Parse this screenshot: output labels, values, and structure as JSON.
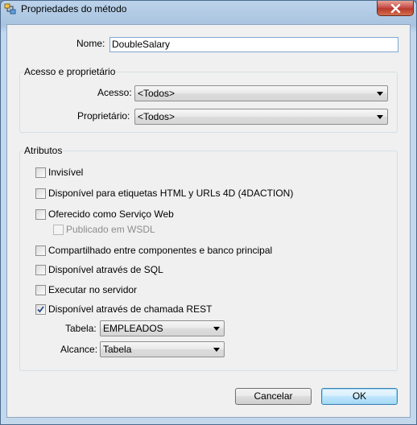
{
  "window": {
    "title": "Propriedades do método"
  },
  "name_field": {
    "label": "Nome:",
    "value": "DoubleSalary"
  },
  "access_group": {
    "title": "Acesso e proprietário",
    "access_label": "Acesso:",
    "access_value": "<Todos>",
    "owner_label": "Proprietário:",
    "owner_value": "<Todos>"
  },
  "attributes_group": {
    "title": "Atributos",
    "invisible": {
      "label": "Invisível",
      "checked": false
    },
    "html_tags": {
      "label": "Disponível para etiquetas HTML y URLs 4D (4DACTION)",
      "checked": false
    },
    "web_service": {
      "label": "Oferecido como Serviço Web",
      "checked": false
    },
    "wsdl": {
      "label": "Publicado em WSDL",
      "checked": false,
      "enabled": false
    },
    "shared": {
      "label": "Compartilhado entre componentes e banco principal",
      "checked": false
    },
    "sql": {
      "label": "Disponível através de SQL",
      "checked": false
    },
    "server": {
      "label": "Executar no servidor",
      "checked": false
    },
    "rest": {
      "label": "Disponível através de chamada REST",
      "checked": true
    },
    "table_label": "Tabela:",
    "table_value": "EMPLEADOS",
    "scope_label": "Alcance:",
    "scope_value": "Tabela"
  },
  "buttons": {
    "cancel": "Cancelar",
    "ok": "OK"
  }
}
